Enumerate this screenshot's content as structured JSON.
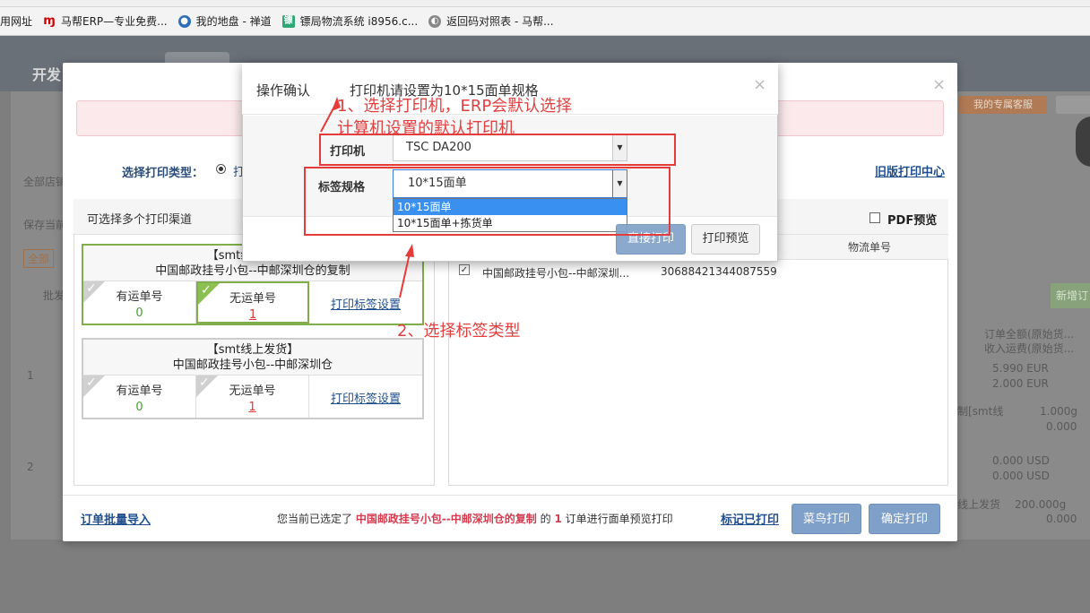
{
  "bookmarks": [
    {
      "label": "用网址",
      "icon": "none"
    },
    {
      "label": "马帮ERP—专业免费...",
      "icon": "mabang-logo-icon"
    },
    {
      "label": "我的地盘 - 禅道",
      "icon": "zentao-icon"
    },
    {
      "label": "镖局物流系统 i8956.c...",
      "icon": "biaoju-icon"
    },
    {
      "label": "返回码对照表 - 马帮...",
      "icon": "globe-icon"
    }
  ],
  "app": {
    "title": "开发"
  },
  "background": {
    "my_service": "我的专属客服",
    "left_snippets": [
      "全部店铺",
      "保存当前",
      "全部",
      "批发",
      "1",
      "2"
    ],
    "new_button": "新增订",
    "right_col": [
      "订单全额(原始货...",
      "收入运费(原始货..."
    ],
    "amounts1": [
      "5.990 EUR",
      "2.000 EUR"
    ],
    "snip1": "制[smt线",
    "weights1": [
      "1.000g",
      "0.000"
    ],
    "amounts2": [
      "0.000 USD",
      "0.000 USD"
    ],
    "snip2": "线上发货",
    "weights2": [
      "200.000g",
      "0.000"
    ]
  },
  "modal": {
    "print_type_label": "选择打印类型：",
    "print_type_option": "打",
    "old_print_center": "旧版打印中心",
    "left_title": "可选择多个打印渠道",
    "cards": [
      {
        "title": "【smt线上发货】",
        "subtitle": "中国邮政挂号小包--中邮深圳仓的复制",
        "has_track_label": "有运单号",
        "has_track_count": "0",
        "no_track_label": "无运单号",
        "no_track_count": "1",
        "settings_link": "打印标签设置"
      },
      {
        "title": "【smt线上发货】",
        "subtitle": "中国邮政挂号小包--中邮深圳仓",
        "has_track_label": "有运单号",
        "has_track_count": "0",
        "no_track_label": "无运单号",
        "no_track_count": "1",
        "settings_link": "打印标签设置"
      }
    ],
    "pdf_preview": "PDF预览",
    "col_tracking": "物流单号",
    "rows": [
      {
        "channel": "中国邮政挂号小包--中邮深圳...",
        "tracking": "30688421344087559"
      }
    ],
    "footer": {
      "batch_import": "订单批量导入",
      "msg_pre": "您当前已选定了",
      "msg_channel": "中国邮政挂号小包--中邮深圳仓的复制",
      "msg_mid": "的",
      "msg_count": "1",
      "msg_post": "订单进行面单预览打印",
      "mark_printed": "标记已打印",
      "cainiao_print": "菜鸟打印",
      "confirm_print": "确定打印"
    }
  },
  "confirm": {
    "title": "操作确认",
    "description": "打印机请设置为10*15面单规格",
    "printer_label": "打印机",
    "printer_value": "TSC DA200",
    "size_label": "标签规格",
    "size_value": "10*15面单",
    "size_options": [
      "10*15面单",
      "10*15面单+拣货单"
    ],
    "direct_print": "直接打印",
    "preview_print": "打印预览"
  },
  "annotations": {
    "step1_line1": "1、选择打印机，ERP会默认选择",
    "step1_line2": "计算机设置的默认打印机",
    "step2": "2、选择标签类型"
  },
  "colors": {
    "annotation_red": "#e63b3b",
    "active_green": "#7fae4a",
    "link_blue": "#1f4f8f",
    "button_blue": "#7fa0c8"
  }
}
